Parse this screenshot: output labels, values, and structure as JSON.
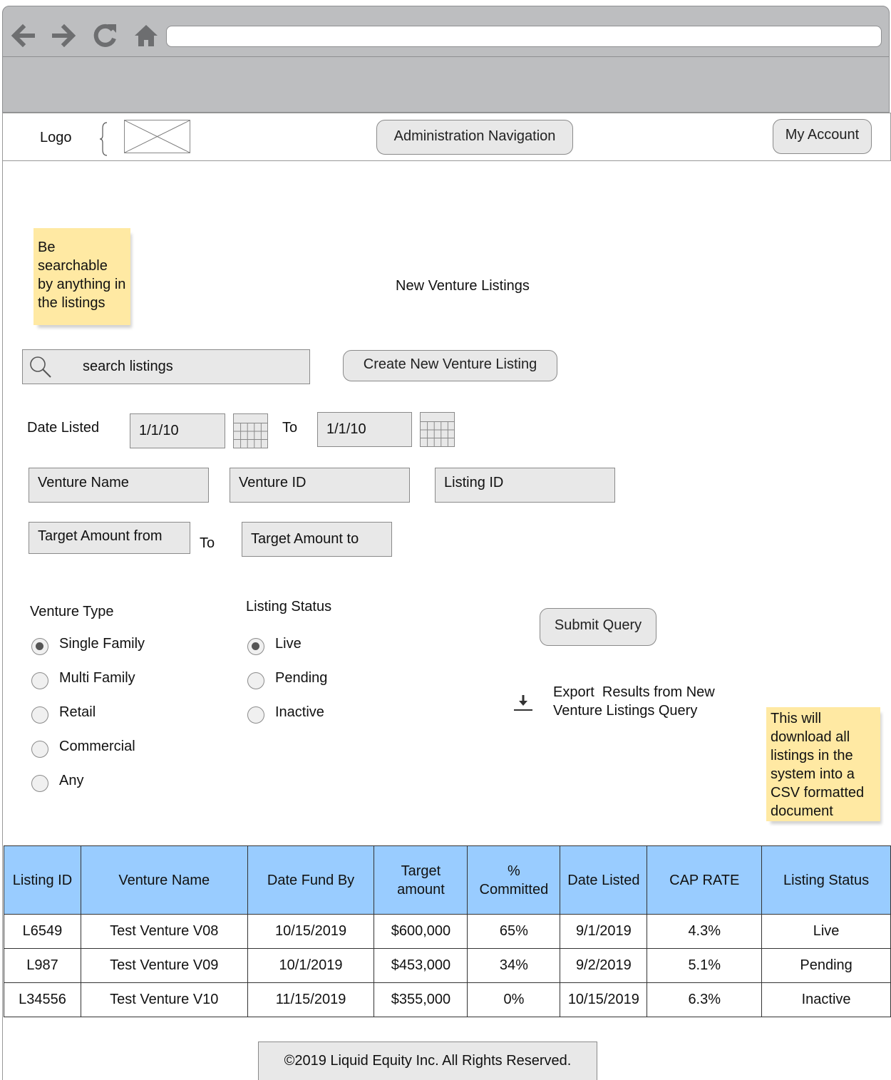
{
  "browser": {
    "back_icon": "arrow-left-icon",
    "forward_icon": "arrow-right-icon",
    "reload_icon": "reload-icon",
    "home_icon": "home-icon",
    "address": ""
  },
  "header": {
    "logo_label": "Logo",
    "admin_nav_label": "Administration Navigation",
    "my_account_label": "My Account"
  },
  "notes": {
    "search_note": "Be searchable by anything in the listings",
    "export_note": "This will download all listings in the system into a CSV formatted document"
  },
  "main": {
    "page_title": "New Venture Listings",
    "search_placeholder": "search listings",
    "create_button": "Create New Venture Listing",
    "date_listed_label": "Date Listed",
    "date_from": "1/1/10",
    "date_to_label": "To",
    "date_to": "1/1/10",
    "venture_name_field": "Venture Name",
    "venture_id_field": "Venture ID",
    "listing_id_field": "Listing ID",
    "target_from_field": "Target Amount from",
    "target_to_label": "To",
    "target_to_field": "Target Amount to",
    "venture_type_label": "Venture Type",
    "venture_types": [
      {
        "label": "Single Family",
        "selected": true
      },
      {
        "label": "Multi Family",
        "selected": false
      },
      {
        "label": "Retail",
        "selected": false
      },
      {
        "label": "Commercial",
        "selected": false
      },
      {
        "label": "Any",
        "selected": false
      }
    ],
    "listing_status_label": "Listing Status",
    "listing_statuses": [
      {
        "label": "Live",
        "selected": true
      },
      {
        "label": "Pending",
        "selected": false
      },
      {
        "label": "Inactive",
        "selected": false
      }
    ],
    "submit_button": "Submit Query",
    "export_line1": "Export  Results from New",
    "export_line2": "Venture Listings Query"
  },
  "table": {
    "headers": [
      "Listing ID",
      "Venture Name",
      "Date Fund By",
      "Target amount",
      "% Committed",
      "Date Listed",
      "CAP RATE",
      "Listing Status"
    ],
    "rows": [
      [
        "L6549",
        "Test Venture V08",
        "10/15/2019",
        "$600,000",
        "65%",
        "9/1/2019",
        "4.3%",
        "Live"
      ],
      [
        "L987",
        "Test Venture V09",
        "10/1/2019",
        "$453,000",
        "34%",
        "9/2/2019",
        "5.1%",
        "Pending"
      ],
      [
        "L34556",
        "Test Venture V10",
        "11/15/2019",
        "$355,000",
        "0%",
        "10/15/2019",
        "6.3%",
        "Inactive"
      ]
    ]
  },
  "footer": {
    "copyright": "©2019 Liquid Equity Inc. All Rights Reserved."
  },
  "colors": {
    "table_header": "#99ccff",
    "sticky_note": "#ffe9a3",
    "chrome": "#bdbec0"
  }
}
